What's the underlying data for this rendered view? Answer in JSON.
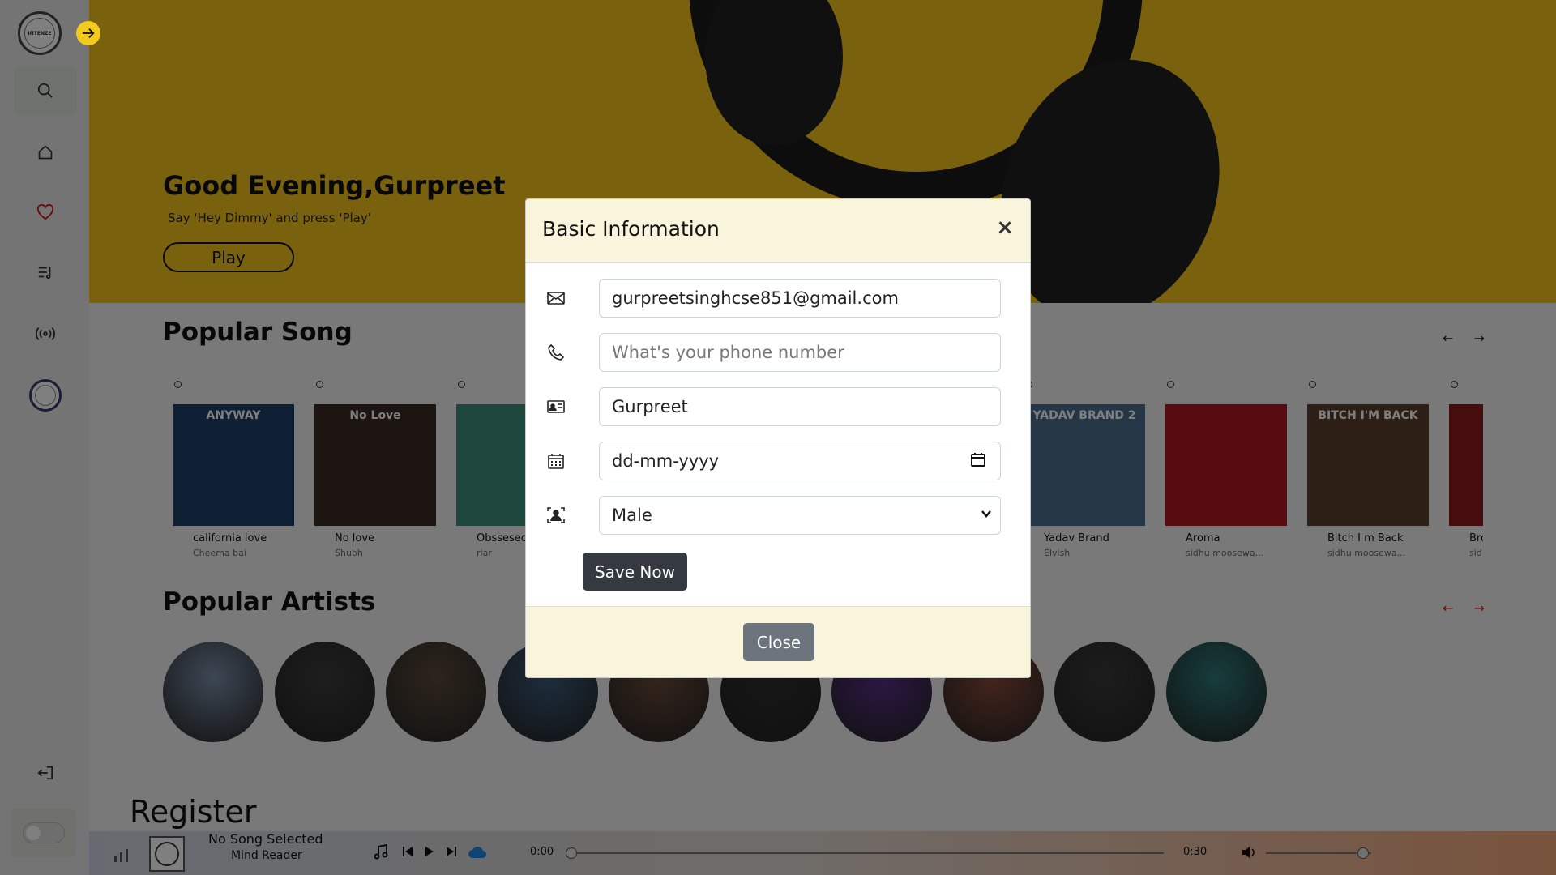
{
  "sidebar": {
    "logo_text": "INTENZE",
    "icons": [
      "search-icon",
      "home-icon",
      "heart-icon",
      "playlist-icon",
      "radio-icon"
    ]
  },
  "hero": {
    "greeting": "Good Evening,Gurpreet",
    "subtitle": "Say 'Hey Dimmy' and press 'Play'",
    "play_label": "Play",
    "background_color": "#f2c21b"
  },
  "popular_songs": {
    "title": "Popular Song",
    "arrows": "← →",
    "items": [
      {
        "title": "california love",
        "artist": "Cheema bai",
        "cover_text": "ANYWAY",
        "color": "#1f3e68"
      },
      {
        "title": "No love",
        "artist": "Shubh",
        "cover_text": "No Love",
        "color": "#3a2a22"
      },
      {
        "title": "Obssesed",
        "artist": "riar",
        "cover_text": "",
        "color": "#3a8f7a"
      },
      {
        "title": "",
        "artist": "",
        "cover_text": "",
        "color": "#444"
      },
      {
        "title": "",
        "artist": "",
        "cover_text": "",
        "color": "#555"
      },
      {
        "title": "",
        "artist": "",
        "cover_text": "",
        "color": "#666"
      },
      {
        "title": "Yadav Brand",
        "artist": "Elvish",
        "cover_text": "YADAV BRAND 2",
        "color": "#4b6f8e"
      },
      {
        "title": "Aroma",
        "artist": "sidhu moosewa...",
        "cover_text": "",
        "color": "#b3181e"
      },
      {
        "title": "Bitch I m Back",
        "artist": "sidhu moosewa...",
        "cover_text": "BITCH I'M BACK",
        "color": "#5a3e2a"
      },
      {
        "title": "Bro",
        "artist": "sid",
        "cover_text": "",
        "color": "#8a1a1a"
      }
    ]
  },
  "popular_artists": {
    "title": "Popular Artists",
    "arrows": "← →",
    "colors": [
      "#7a8fa8",
      "#3c3c3c",
      "#5a4a3a",
      "#3b5a7a",
      "#6a4a3a",
      "#2e2e2e",
      "#5a2e8a",
      "#8a4a3a",
      "#3a3a3a",
      "#2e7a7a"
    ]
  },
  "register": {
    "title": "Register"
  },
  "player": {
    "title": "No Song Selected",
    "subtitle": "Mind Reader",
    "time_current": "0:00",
    "time_total": "0:30"
  },
  "modal": {
    "title": "Basic Information",
    "close_symbol": "×",
    "email_value": "gurpreetsinghcse851@gmail.com",
    "phone_placeholder": "What's your phone number",
    "name_value": "Gurpreet",
    "dob_placeholder": "dd-mm-yyyy",
    "gender_value": "Male",
    "save_label": "Save Now",
    "close_label": "Close"
  }
}
